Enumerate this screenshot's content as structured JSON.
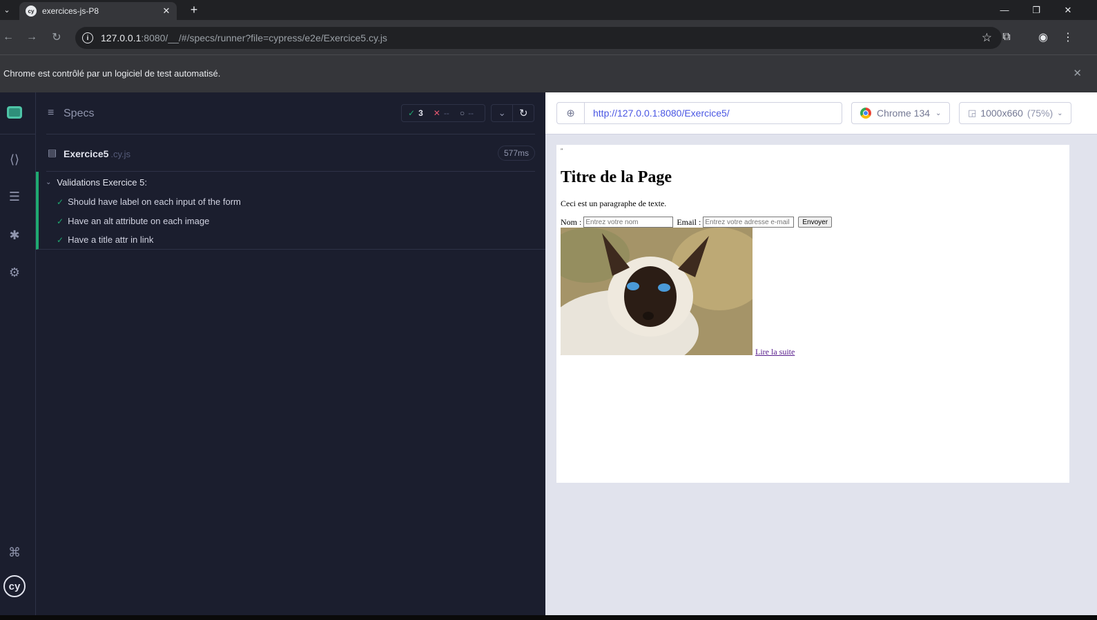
{
  "browser": {
    "tab_title": "exercices-js-P8",
    "tab_favicon": "cy",
    "url_host": "127.0.0.1",
    "url_rest": ":8080/__/#/specs/runner?file=cypress/e2e/Exercice5.cy.js",
    "infobar_text": "Chrome est contrôlé par un logiciel de test automatisé."
  },
  "reporter": {
    "specs_label": "Specs",
    "stats": {
      "passed": "3",
      "failed": "--",
      "pending": "--"
    },
    "spec_name": "Exercice5",
    "spec_ext": ".cy.js",
    "duration": "577ms",
    "suite_title": "Validations Exercice 5:",
    "tests": [
      "Should have label on each input of the form",
      "Have an alt attribute on each image",
      "Have a title attr in link"
    ]
  },
  "aut": {
    "url": "http://127.0.0.1:8080/Exercice5/",
    "browser_label": "Chrome 134",
    "viewport_label": "1000x660",
    "viewport_scale": "(75%)"
  },
  "page": {
    "marker": "\"",
    "heading": "Titre de la Page",
    "paragraph": "Ceci est un paragraphe de texte.",
    "name_label": "Nom :",
    "name_placeholder": "Entrez votre nom",
    "email_label": "Email :",
    "email_placeholder": "Entrez votre adresse e-mail",
    "submit_label": "Envoyer",
    "link_text": "Lire la suite"
  },
  "colors": {
    "pass": "#1fa971",
    "fail": "#e45770",
    "link": "#4956e3",
    "reporter_bg": "#1b1e2e"
  }
}
